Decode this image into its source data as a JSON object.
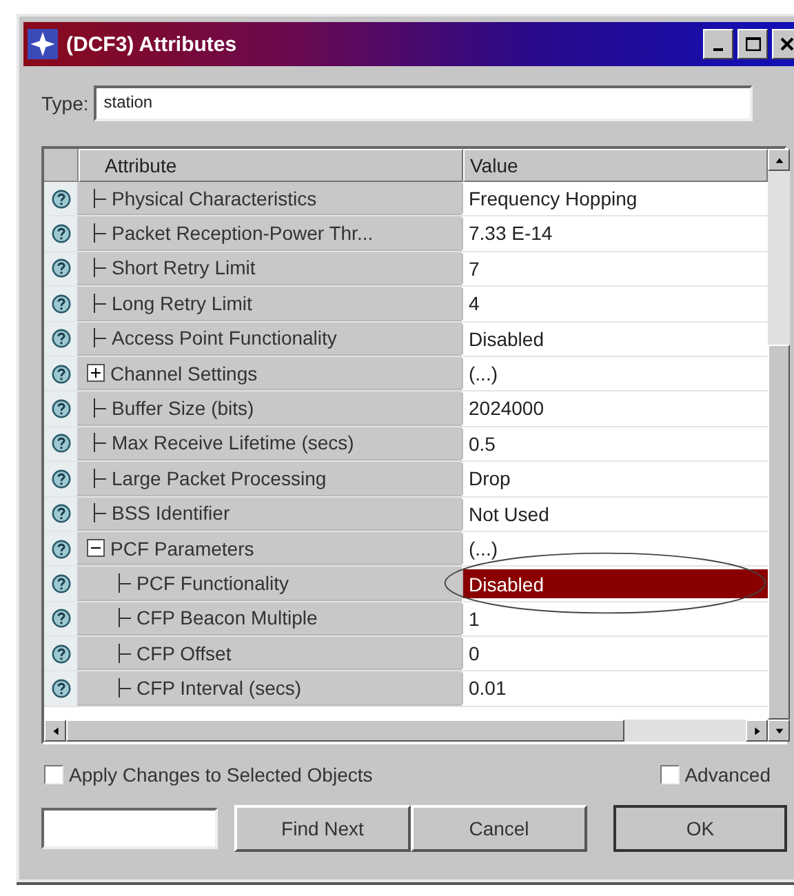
{
  "window": {
    "title": "(DCF3) Attributes"
  },
  "type_field": {
    "label": "Type:",
    "value": "station"
  },
  "table": {
    "columns": [
      "Attribute",
      "Value"
    ],
    "rows": [
      {
        "attribute": "Physical Characteristics",
        "value": "Frequency Hopping",
        "selected": false
      },
      {
        "attribute": "Packet Reception-Power Thr...",
        "value": "7.33 E-14",
        "selected": false
      },
      {
        "attribute": "Short Retry Limit",
        "value": "7",
        "selected": false
      },
      {
        "attribute": "Long Retry Limit",
        "value": "4",
        "selected": false
      },
      {
        "attribute": "Access Point Functionality",
        "value": "Disabled",
        "selected": false
      },
      {
        "attribute": "Channel Settings",
        "value": "(...)",
        "selected": false,
        "expanded": false
      },
      {
        "attribute": "Buffer Size (bits)",
        "value": "2024000",
        "selected": false
      },
      {
        "attribute": "Max Receive Lifetime (secs)",
        "value": "0.5",
        "selected": false
      },
      {
        "attribute": "Large Packet Processing",
        "value": "Drop",
        "selected": false
      },
      {
        "attribute": "BSS Identifier",
        "value": "Not Used",
        "selected": false
      },
      {
        "attribute": "PCF Parameters",
        "value": "(...)",
        "selected": false,
        "expanded": true,
        "children": [
          {
            "attribute": "PCF Functionality",
            "value": "Disabled",
            "selected": true
          },
          {
            "attribute": "CFP Beacon Multiple",
            "value": "1",
            "selected": false
          },
          {
            "attribute": "CFP Offset",
            "value": "0",
            "selected": false
          },
          {
            "attribute": "CFP Interval (secs)",
            "value": "0.01",
            "selected": false
          }
        ]
      }
    ]
  },
  "checkboxes": [
    {
      "label": "Apply Changes to Selected Objects",
      "checked": false
    },
    {
      "label": "Advanced",
      "checked": false
    }
  ],
  "buttons": [
    "Find Next",
    "Cancel",
    "OK"
  ]
}
